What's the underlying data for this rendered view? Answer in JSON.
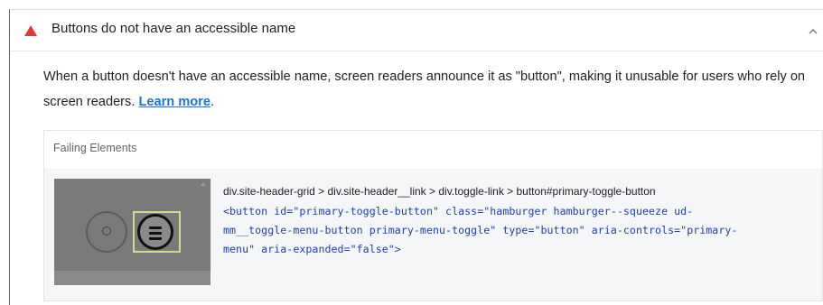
{
  "audit": {
    "status_icon": "warning-triangle-icon",
    "title": "Buttons do not have an accessible name",
    "toggle_icon": "chevron-up-icon",
    "description_text": "When a button doesn't have an accessible name, screen readers announce it as \"button\", making it unusable for users who rely on screen readers. ",
    "learn_more_label": "Learn more",
    "description_end": "."
  },
  "details": {
    "heading": "Failing Elements",
    "items": [
      {
        "thumbnail": "element-screenshot",
        "selector": "div.site-header-grid > div.site-header__link > div.toggle-link > button#primary-toggle-button",
        "snippet_lines": [
          "<button id=\"primary-toggle-button\" class=\"hamburger hamburger--squeeze ud-",
          "mm__toggle-menu-button primary-menu-toggle\" type=\"button\" aria-controls=\"primary-",
          "menu\" aria-expanded=\"false\">"
        ]
      }
    ]
  },
  "colors": {
    "warning": "#e53935",
    "link": "#1a73e8",
    "code": "#1e40af",
    "highlight": "#d4d98a"
  }
}
